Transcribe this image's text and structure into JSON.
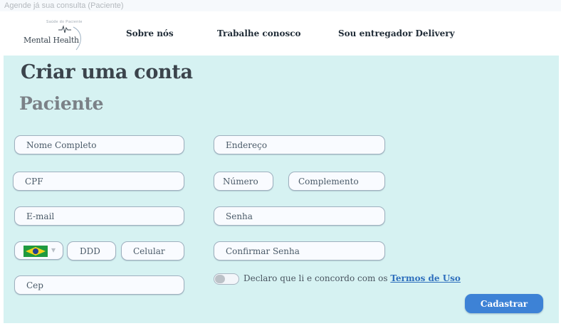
{
  "window": {
    "title": "Agende já sua consulta (Paciente)"
  },
  "header": {
    "logo": {
      "text": "Mental Health",
      "arc_text": "Saúde do Paciente"
    },
    "nav": [
      {
        "label": "Sobre nós"
      },
      {
        "label": "Trabalhe conosco"
      },
      {
        "label": "Sou entregador Delivery"
      }
    ]
  },
  "form": {
    "title": "Criar uma conta",
    "subtitle": "Paciente",
    "fields": {
      "nome_completo": {
        "placeholder": "Nome Completo",
        "value": ""
      },
      "endereco": {
        "placeholder": "Endereço",
        "value": ""
      },
      "cpf": {
        "placeholder": "CPF",
        "value": ""
      },
      "numero": {
        "placeholder": "Número",
        "value": ""
      },
      "complemento": {
        "placeholder": "Complemento",
        "value": ""
      },
      "email": {
        "placeholder": "E-mail",
        "value": ""
      },
      "senha": {
        "placeholder": "Senha",
        "value": ""
      },
      "ddd": {
        "placeholder": "DDD",
        "value": ""
      },
      "celular": {
        "placeholder": "Celular",
        "value": ""
      },
      "confirmar_senha": {
        "placeholder": "Confirmar Senha",
        "value": ""
      },
      "cep": {
        "placeholder": "Cep",
        "value": ""
      }
    },
    "country": {
      "selected": "brazil-flag",
      "caret": "▾"
    },
    "terms": {
      "prefix": "Declaro que li e concordo com os ",
      "link_label": "Termos de Uso",
      "accepted": false
    },
    "submit_label": "Cadastrar"
  },
  "colors": {
    "background": "#d6f2f2",
    "field_bg": "#f9fbff",
    "field_border": "#9fb0bf",
    "primary_button": "#3d82d6",
    "link": "#2e6fbd"
  }
}
